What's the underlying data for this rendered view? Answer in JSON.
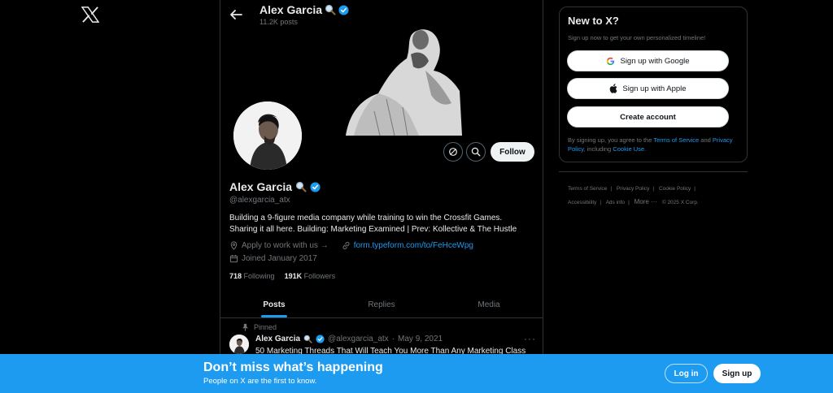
{
  "brand": {
    "logo_icon": "x-logo-icon"
  },
  "header": {
    "name": "Alex Garcia",
    "posts_count": "11.2K posts"
  },
  "profile": {
    "name": "Alex Garcia",
    "handle": "@alexgarcia_atx",
    "bio_line1": "Building a 9-figure media company while training to win the Crossfit Games.",
    "bio_line2": "Sharing it all here. Building: Marketing Examined | Prev: Kollective & The Hustle",
    "professional_category": "Apply to work with us →",
    "website": "form.typeform.com/to/FeHceWpg",
    "joined": "Joined January 2017",
    "following_count": "718",
    "following_label": "Following",
    "followers_count": "191K",
    "followers_label": "Followers",
    "follow_label": "Follow"
  },
  "tabs": [
    {
      "label": "Posts",
      "active": true
    },
    {
      "label": "Replies",
      "active": false
    },
    {
      "label": "Media",
      "active": false
    }
  ],
  "pinned_post": {
    "pinned_label": "Pinned",
    "author": "Alex Garcia",
    "handle": "@alexgarcia_atx",
    "separator": "·",
    "date": "May 9, 2021",
    "text": "50 Marketing Threads That Will Teach You More Than Any Marketing Class",
    "more_label": "···"
  },
  "sidebar": {
    "title": "New to X?",
    "subtitle": "Sign up now to get your own personalized timeline!",
    "google_button": "Sign up with Google",
    "apple_button": "Sign up with Apple",
    "create_button": "Create account",
    "terms_prefix": "By signing up, you agree to the ",
    "terms_link": "Terms of Service",
    "terms_and": " and ",
    "privacy_link": "Privacy Policy",
    "terms_including": ", including ",
    "cookie_link": "Cookie Use",
    "terms_end": "."
  },
  "footer": {
    "terms": "Terms of Service",
    "privacy": "Privacy Policy",
    "cookie": "Cookie Policy",
    "accessibility": "Accessibility",
    "ads": "Ads info",
    "more": "More ···",
    "copyright": "© 2025 X Corp.",
    "separator": "|"
  },
  "bottom_bar": {
    "title": "Don’t miss what’s happening",
    "subtitle": "People on X are the first to know.",
    "login_label": "Log in",
    "signup_label": "Sign up"
  },
  "colors": {
    "accent": "#1d9bf0",
    "background": "#000000",
    "text_secondary": "#71767b"
  }
}
